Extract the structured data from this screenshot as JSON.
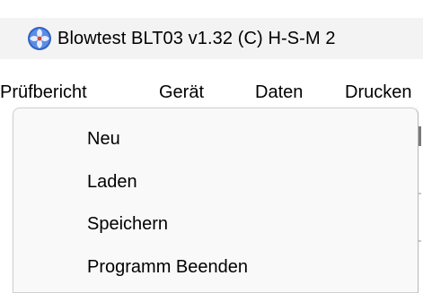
{
  "window": {
    "title": "Blowtest BLT03 v1.32 (C) H-S-M  2",
    "icon": "blue-white-app-icon"
  },
  "menubar": {
    "items": [
      {
        "label": "Prüfbericht",
        "open": true
      },
      {
        "label": "Gerät"
      },
      {
        "label": "Daten"
      },
      {
        "label": "Drucken"
      }
    ]
  },
  "dropdown": {
    "items": [
      {
        "label": "Neu"
      },
      {
        "label": "Laden"
      },
      {
        "label": "Speichern"
      },
      {
        "label": "Programm Beenden"
      }
    ]
  },
  "colors": {
    "titlebar_bg": "#f3f3f3",
    "menu_bg": "#f9f9f9",
    "text": "#000000",
    "icon_blue": "#3a6fd0"
  }
}
